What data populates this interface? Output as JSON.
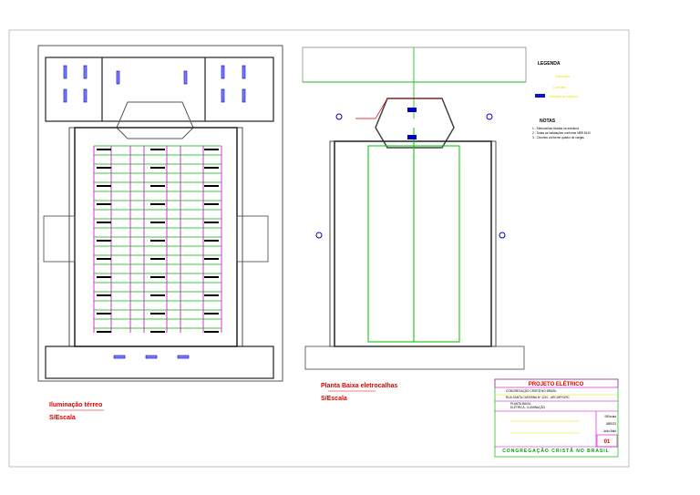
{
  "left_plan": {
    "title": "Iluminação térreo",
    "scale": "S/Escala"
  },
  "right_plan": {
    "title": "Planta Baixa eletrocalhas",
    "scale": "S/Escala"
  },
  "legend": {
    "title": "LEGENDA",
    "items": [
      "Eletrocalha",
      "Luminária",
      "Luminária de sobrepor"
    ],
    "notes_title": "NOTAS",
    "notes": [
      "1 - Eletrocalhas fixadas na estrutura",
      "2 - Todas as instalações conforme NBR 5410",
      "3 - Circuitos conforme quadro de cargas"
    ]
  },
  "title_block": {
    "header": "PROJETO ELÉTRICO",
    "client": "CONGREGAÇÃO CRISTÃ NO BRASIL",
    "address": "RUA SANTA CATARINA Nº 1210 - ARCURYS/SC",
    "drawing": "PLANTA BAIXA",
    "subject": "ELÉTRICA - ILUMINAÇÃO",
    "scale": "S/Escala",
    "date": "ABR/23",
    "author": "João Bald",
    "sheet": "01",
    "footer": "CONGREGAÇÃO CRISTÃ NO BRASIL"
  },
  "colors": {
    "lights": "#00b000",
    "circuits": "#d000d0",
    "fixtures": "#0000c0",
    "text": "#e00000"
  }
}
